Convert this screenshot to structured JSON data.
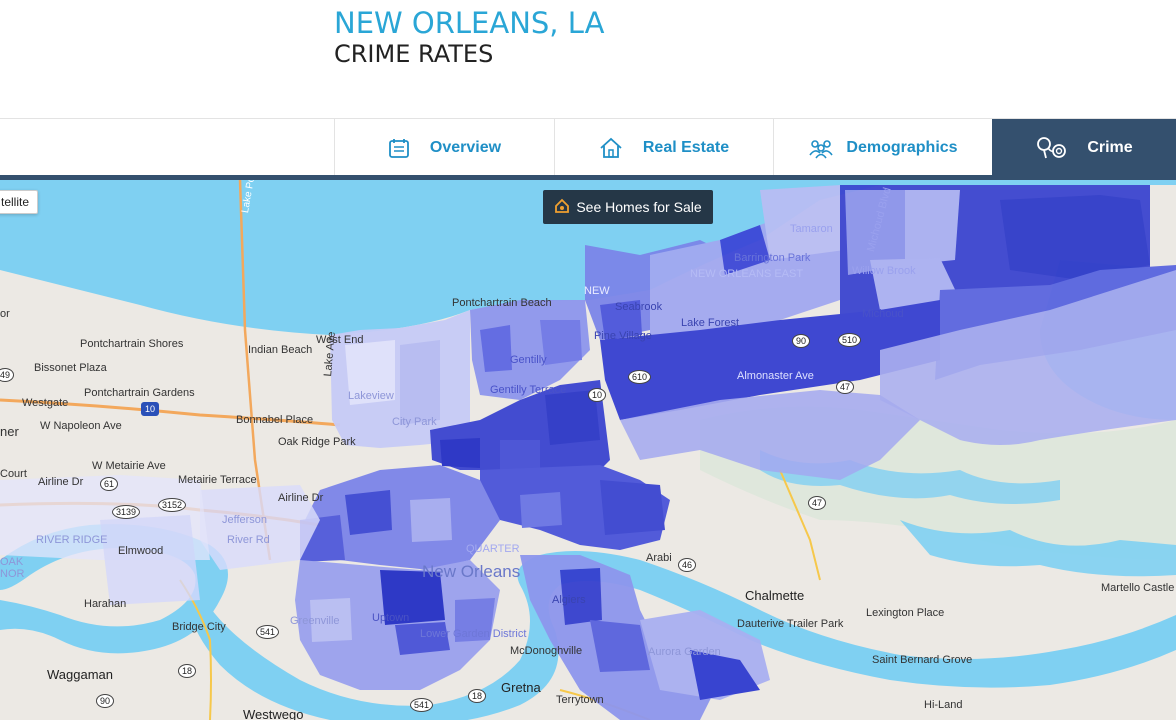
{
  "header": {
    "city": "NEW ORLEANS, LA",
    "subtitle": "CRIME RATES"
  },
  "tabs": [
    {
      "label": "Overview",
      "icon": "calendar-icon",
      "active": false
    },
    {
      "label": "Real Estate",
      "icon": "house-icon",
      "active": false
    },
    {
      "label": "Demographics",
      "icon": "people-icon",
      "active": false
    },
    {
      "label": "Crime",
      "icon": "handcuffs-icon",
      "active": true
    }
  ],
  "map": {
    "satellite_label": "tellite",
    "homes_button": "See Homes for Sale",
    "colors": {
      "water": "#7fd0f2",
      "land": "#ece9e4",
      "crime_high": "#2f3bd3",
      "crime_low": "#c9cdf5"
    },
    "labels": {
      "pontchartrain_beach": "Pontchartrain Beach",
      "lake_pontchartrain_causeway": "Lake Pontchartrain Cause",
      "pontchartrain_shores": "Pontchartrain Shores",
      "bissonet_plaza": "Bissonet Plaza",
      "pontchartrain_gardens": "Pontchartrain Gardens",
      "westgate": "Westgate",
      "w_napoleon_ave": "W Napoleon Ave",
      "indian_beach": "Indian Beach",
      "bonnabel_place": "Bonnabel Place",
      "oak_ridge_park": "Oak Ridge Park",
      "w_metairie_ave": "W Metairie Ave",
      "airline_dr": "Airline Dr",
      "airline_dr_2": "Airline Dr",
      "metairie_terrace": "Metairie Terrace",
      "court": "Court",
      "elmwood": "Elmwood",
      "river_ridge": "RIVER RIDGE",
      "harahan": "Harahan",
      "bridge_city": "Bridge City",
      "waggaman": "Waggaman",
      "westwego": "Westwego",
      "gretna": "Gretna",
      "terrytown": "Terrytown",
      "mcdonoghville": "McDonoghville",
      "arabi": "Arabi",
      "chalmette": "Chalmette",
      "lexington_place": "Lexington Place",
      "dauterive_trailer_park": "Dauterive Trailer Park",
      "saint_bernard_grove": "Saint Bernard Grove",
      "martello_castle": "Martello Castle",
      "hi_land": "Hi-Land",
      "new_orleans": "New Orleans",
      "almonaster_ave": "Almonaster Ave",
      "lake_forest": "Lake Forest",
      "pine_village": "Pine Village",
      "seabrook": "Seabrook",
      "gentilly": "Gentilly",
      "gentilly_terrace": "Gentilly Terrace",
      "lakeview": "Lakeview",
      "city_park": "City Park",
      "uptown": "Uptown",
      "algiers": "Algiers",
      "aurora_gardens": "Aurora Garden",
      "barrington_park": "Barrington Park",
      "tamaron": "Tamaron",
      "willow_brook": "Willow Brook",
      "michoud": "Michoud",
      "michoud_blvd": "Michoud Blvd",
      "lower_garden_district": "Lower Garden District",
      "french_quarter": "QUARTER",
      "new_east": "NEW ORLEANS EAST",
      "jefferson": "Jefferson",
      "river_ridge_rd": "River Rd",
      "lake_ave": "Lake Ave",
      "west_end": "West End",
      "greenville": "Greenville",
      "ner": "ner",
      "nor": "NOR",
      "oak": "OAK",
      "or": "or",
      "new": "NEW"
    },
    "shields": [
      "49",
      "10",
      "61",
      "3152",
      "3139",
      "541",
      "18",
      "90",
      "541",
      "18",
      "46",
      "47",
      "610",
      "10",
      "510",
      "47",
      "90"
    ]
  }
}
